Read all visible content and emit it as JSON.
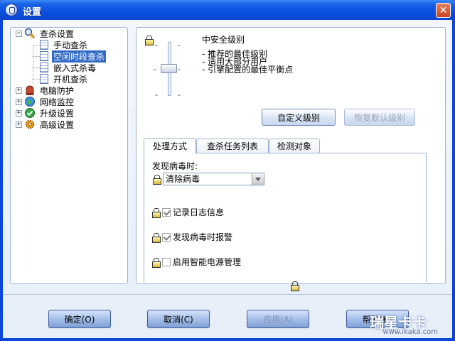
{
  "window": {
    "title": "设置",
    "close_glyph": "✕"
  },
  "tree": {
    "items": [
      {
        "label": "查杀设置",
        "expander": "−",
        "icon": "magnifier-shield-icon"
      },
      {
        "label": "手动查杀",
        "icon": "document-icon"
      },
      {
        "label": "空闲时段查杀",
        "icon": "document-icon",
        "selected": true
      },
      {
        "label": "嵌入式杀毒",
        "icon": "document-icon"
      },
      {
        "label": "开机查杀",
        "icon": "document-icon"
      },
      {
        "label": "电脑防护",
        "expander": "+",
        "icon": "glove-icon"
      },
      {
        "label": "网络监控",
        "expander": "+",
        "icon": "globe-icon"
      },
      {
        "label": "升级设置",
        "expander": "+",
        "icon": "green-check-icon"
      },
      {
        "label": "高级设置",
        "expander": "+",
        "icon": "gear-icon"
      }
    ]
  },
  "security_level": {
    "title": "中安全级别",
    "descriptions": [
      "- 推荐的最佳级别",
      "- 适用大部分用户",
      "- 引擎配置的最佳平衡点"
    ],
    "tick": "-",
    "custom_button": "自定义级别",
    "restore_button": "恢复默认级别"
  },
  "tabs": [
    {
      "label": "处理方式",
      "active": true
    },
    {
      "label": "查杀任务列表"
    },
    {
      "label": "检测对象"
    }
  ],
  "handling": {
    "found_label": "发现病毒时:",
    "action_value": "清除病毒",
    "options": [
      {
        "label": "记录日志信息",
        "checked": true
      },
      {
        "label": "发现病毒时报警",
        "checked": true
      },
      {
        "label": "启用智能电源管理",
        "checked": false
      }
    ]
  },
  "footer": {
    "ok": "确定(O)",
    "cancel": "取消(C)",
    "apply": "应用(A)",
    "help": "帮助(H)"
  },
  "watermark": {
    "brand": "瑞星卡卡",
    "url": "www.ikaka.com"
  },
  "colors": {
    "title_bar": "#0a4fe0",
    "selection": "#316ac5",
    "panel_border": "#9cb3d3"
  }
}
